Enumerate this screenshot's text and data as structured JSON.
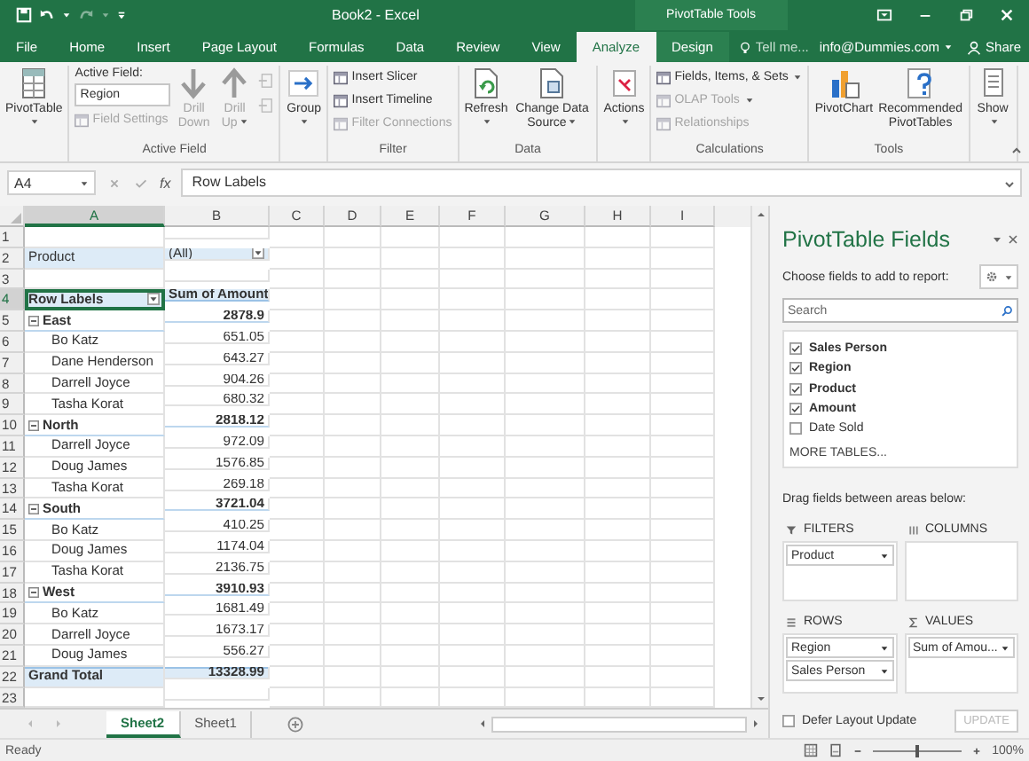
{
  "title_bar": {
    "title": "Book2 - Excel",
    "context": "PivotTable Tools"
  },
  "tabs": [
    {
      "label": "File",
      "selected": false
    },
    {
      "label": "Home",
      "selected": false
    },
    {
      "label": "Insert",
      "selected": false
    },
    {
      "label": "Page Layout",
      "selected": false
    },
    {
      "label": "Formulas",
      "selected": false
    },
    {
      "label": "Data",
      "selected": false
    },
    {
      "label": "Review",
      "selected": false
    },
    {
      "label": "View",
      "selected": false
    },
    {
      "label": "Analyze",
      "selected": true
    },
    {
      "label": "Design",
      "selected": false
    }
  ],
  "tell_me": {
    "placeholder": "Tell me..."
  },
  "account": "info@Dummies.com",
  "share": "Share",
  "ribbon": [
    {
      "columns": [
        {
          "kind": "large",
          "label": "PivotTable",
          "disabled": false,
          "menu": true
        }
      ]
    },
    {
      "label": "Active Field",
      "columns": [
        {
          "kind": "stack",
          "items": [
            {
              "kind": "text",
              "label": "Active Field:"
            },
            {
              "kind": "field",
              "value": "Region"
            },
            {
              "kind": "small",
              "label": "Field Settings",
              "disabled": true
            }
          ]
        },
        {
          "kind": "large",
          "label": "Drill Down",
          "disabled": true,
          "menu": false
        },
        {
          "kind": "large",
          "label": "Drill Up",
          "disabled": true,
          "menu": true
        },
        {
          "kind": "stack",
          "items": [
            {
              "kind": "icon",
              "disabled": true
            },
            {
              "kind": "icon",
              "disabled": true
            }
          ]
        }
      ]
    },
    {
      "columns": [
        {
          "kind": "large",
          "label": "Group",
          "disabled": false,
          "menu": true
        }
      ]
    },
    {
      "label": "Filter",
      "columns": [
        {
          "kind": "stack",
          "items": [
            {
              "kind": "small",
              "label": "Insert Slicer",
              "disabled": false
            },
            {
              "kind": "small",
              "label": "Insert Timeline",
              "disabled": false
            },
            {
              "kind": "small",
              "label": "Filter Connections",
              "disabled": true
            }
          ]
        }
      ]
    },
    {
      "label": "Data",
      "columns": [
        {
          "kind": "large",
          "label": "Refresh",
          "disabled": false,
          "menu": true
        },
        {
          "kind": "large",
          "label": "Change Data Source",
          "disabled": false,
          "menu": true
        }
      ]
    },
    {
      "columns": [
        {
          "kind": "large",
          "label": "Actions",
          "disabled": false,
          "menu": true
        }
      ]
    },
    {
      "label": "Calculations",
      "columns": [
        {
          "kind": "stack",
          "items": [
            {
              "kind": "small",
              "label": "Fields, Items, & Sets",
              "disabled": false,
              "menu": true
            },
            {
              "kind": "small",
              "label": "OLAP Tools",
              "disabled": true,
              "menu": true
            },
            {
              "kind": "small",
              "label": "Relationships",
              "disabled": true
            }
          ]
        }
      ]
    },
    {
      "label": "Tools",
      "columns": [
        {
          "kind": "large",
          "label": "PivotChart",
          "disabled": false,
          "menu": false
        },
        {
          "kind": "large",
          "label": "Recommended PivotTables",
          "disabled": false,
          "menu": false
        }
      ]
    },
    {
      "columns": [
        {
          "kind": "large",
          "label": "Show",
          "disabled": false,
          "menu": true
        }
      ]
    }
  ],
  "formula_bar": {
    "name_box": "A4",
    "fx": "fx",
    "formula": "Row Labels"
  },
  "columns": [
    "A",
    "B",
    "C",
    "D",
    "E",
    "F",
    "G",
    "H",
    "I"
  ],
  "rows": [
    {
      "n": "1",
      "kind": "blank",
      "selected": false
    },
    {
      "n": "2",
      "kind": "filter",
      "label": "Product",
      "value": "(All)",
      "selected": false
    },
    {
      "n": "3",
      "kind": "blank",
      "selected": false
    },
    {
      "n": "4",
      "kind": "header",
      "label": "Row Labels",
      "value": "Sum of Amount",
      "selected": true
    },
    {
      "n": "5",
      "kind": "group",
      "label": "East",
      "value": "2878.9",
      "expanded": true,
      "selected": false
    },
    {
      "n": "6",
      "kind": "item",
      "label": "Bo Katz",
      "value": "651.05",
      "selected": false
    },
    {
      "n": "7",
      "kind": "item",
      "label": "Dane Henderson",
      "value": "643.27",
      "selected": false
    },
    {
      "n": "8",
      "kind": "item",
      "label": "Darrell Joyce",
      "value": "904.26",
      "selected": false
    },
    {
      "n": "9",
      "kind": "item",
      "label": "Tasha Korat",
      "value": "680.32",
      "selected": false
    },
    {
      "n": "10",
      "kind": "group",
      "label": "North",
      "value": "2818.12",
      "expanded": true,
      "selected": false
    },
    {
      "n": "11",
      "kind": "item",
      "label": "Darrell Joyce",
      "value": "972.09",
      "selected": false
    },
    {
      "n": "12",
      "kind": "item",
      "label": "Doug James",
      "value": "1576.85",
      "selected": false
    },
    {
      "n": "13",
      "kind": "item",
      "label": "Tasha Korat",
      "value": "269.18",
      "selected": false
    },
    {
      "n": "14",
      "kind": "group",
      "label": "South",
      "value": "3721.04",
      "expanded": true,
      "selected": false
    },
    {
      "n": "15",
      "kind": "item",
      "label": "Bo Katz",
      "value": "410.25",
      "selected": false
    },
    {
      "n": "16",
      "kind": "item",
      "label": "Doug James",
      "value": "1174.04",
      "selected": false
    },
    {
      "n": "17",
      "kind": "item",
      "label": "Tasha Korat",
      "value": "2136.75",
      "selected": false
    },
    {
      "n": "18",
      "kind": "group",
      "label": "West",
      "value": "3910.93",
      "expanded": true,
      "selected": false
    },
    {
      "n": "19",
      "kind": "item",
      "label": "Bo Katz",
      "value": "1681.49",
      "selected": false
    },
    {
      "n": "20",
      "kind": "item",
      "label": "Darrell Joyce",
      "value": "1673.17",
      "selected": false
    },
    {
      "n": "21",
      "kind": "item",
      "label": "Doug James",
      "value": "556.27",
      "selected": false
    },
    {
      "n": "22",
      "kind": "total",
      "label": "Grand Total",
      "value": "13328.99",
      "selected": false
    },
    {
      "n": "23",
      "kind": "blank",
      "selected": false
    }
  ],
  "sheet_tabs": [
    {
      "label": "Sheet2",
      "selected": true
    },
    {
      "label": "Sheet1",
      "selected": false
    }
  ],
  "status_bar": {
    "text": "Ready",
    "zoom": "100%",
    "zoom_slider": {
      "level": 0.5
    }
  },
  "field_pane": {
    "title": "PivotTable Fields",
    "subtitle": "Choose fields to add to report:",
    "search": {
      "placeholder": "Search"
    },
    "fields": [
      {
        "label": "Sales Person",
        "checked": true
      },
      {
        "label": "Region",
        "checked": true
      },
      {
        "label": "Product",
        "checked": true
      },
      {
        "label": "Amount",
        "checked": true
      },
      {
        "label": "Date Sold",
        "checked": false
      }
    ],
    "more_tables": "MORE TABLES...",
    "areas_hint": "Drag fields between areas below:",
    "areas": [
      {
        "kind": "filters",
        "label": "FILTERS",
        "items": [
          {
            "label": "Product"
          }
        ]
      },
      {
        "kind": "columns",
        "label": "COLUMNS"
      },
      {
        "kind": "rows",
        "label": "ROWS",
        "items": [
          {
            "label": "Region"
          },
          {
            "label": "Sales Person"
          }
        ]
      },
      {
        "kind": "values",
        "label": "VALUES",
        "items": [
          {
            "label": "Sum of Amou..."
          }
        ]
      }
    ],
    "defer": {
      "label": "Defer Layout Update",
      "checked": false
    },
    "update": {
      "label": "UPDATE",
      "disabled": true
    }
  }
}
